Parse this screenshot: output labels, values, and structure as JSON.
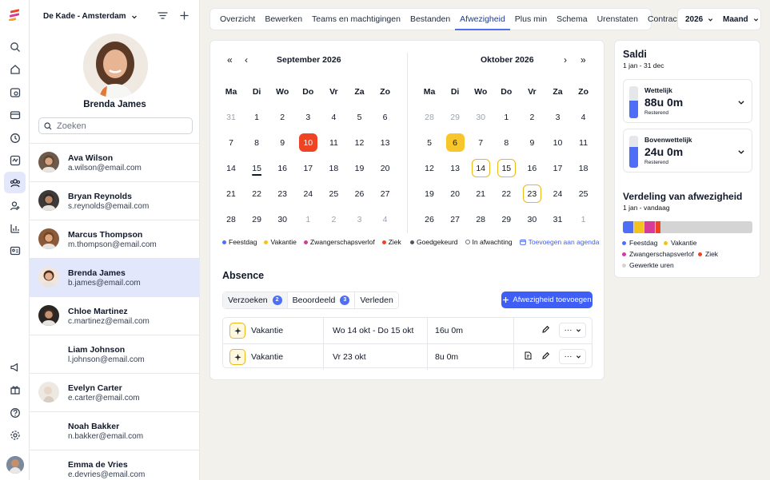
{
  "sidebar": {
    "location": "De Kade - Amsterdam",
    "profile_name": "Brenda James",
    "search_placeholder": "Zoeken",
    "people": [
      {
        "name": "Ava Wilson",
        "email": "a.wilson@email.com",
        "avatar": "photo"
      },
      {
        "name": "Bryan Reynolds",
        "email": "s.reynolds@email.com",
        "avatar": "photo"
      },
      {
        "name": "Marcus Thompson",
        "email": "m.thompson@email.com",
        "avatar": "photo"
      },
      {
        "name": "Brenda James",
        "email": "b.james@email.com",
        "avatar": "photo",
        "selected": true
      },
      {
        "name": "Chloe Martinez",
        "email": "c.martinez@email.com",
        "avatar": "photo"
      },
      {
        "name": "Liam Johnson",
        "email": "l.johnson@email.com",
        "avatar": "none"
      },
      {
        "name": "Evelyn Carter",
        "email": "e.carter@email.com",
        "avatar": "placeholder"
      },
      {
        "name": "Noah Bakker",
        "email": "n.bakker@email.com",
        "avatar": "none"
      },
      {
        "name": "Emma de Vries",
        "email": "e.devries@email.com",
        "avatar": "none"
      }
    ]
  },
  "rail_icons": [
    "search-icon",
    "home-icon",
    "inbox-search-icon",
    "calendar-card-icon",
    "clock-icon",
    "activity-icon",
    "team-icon",
    "add-user-icon",
    "chart-icon",
    "id-card-icon",
    "megaphone-icon",
    "gift-icon",
    "help-icon",
    "settings-icon"
  ],
  "tabs": [
    {
      "label": "Overzicht"
    },
    {
      "label": "Bewerken"
    },
    {
      "label": "Teams en machtigingen"
    },
    {
      "label": "Bestanden"
    },
    {
      "label": "Afwezigheid",
      "active": true
    },
    {
      "label": "Plus min"
    },
    {
      "label": "Schema"
    },
    {
      "label": "Urenstaten"
    },
    {
      "label": "Contracten"
    }
  ],
  "period": {
    "year": "2026",
    "view": "Maand"
  },
  "calendar": {
    "weekdays": [
      "Ma",
      "Di",
      "Wo",
      "Do",
      "Vr",
      "Za",
      "Zo"
    ],
    "months": [
      {
        "title": "September 2026",
        "days": [
          [
            "31",
            1
          ],
          [
            "1",
            0
          ],
          [
            "2",
            0
          ],
          [
            "3",
            0
          ],
          [
            "4",
            0
          ],
          [
            "5",
            0
          ],
          [
            "6",
            0
          ],
          [
            "7",
            0
          ],
          [
            "8",
            0
          ],
          [
            "9",
            0
          ],
          [
            "10",
            2
          ],
          [
            "11",
            0
          ],
          [
            "12",
            0
          ],
          [
            "13",
            0
          ],
          [
            "14",
            0
          ],
          [
            "15",
            3
          ],
          [
            "16",
            0
          ],
          [
            "17",
            0
          ],
          [
            "18",
            0
          ],
          [
            "19",
            0
          ],
          [
            "20",
            0
          ],
          [
            "21",
            0
          ],
          [
            "22",
            0
          ],
          [
            "23",
            0
          ],
          [
            "24",
            0
          ],
          [
            "25",
            0
          ],
          [
            "26",
            0
          ],
          [
            "27",
            0
          ],
          [
            "28",
            0
          ],
          [
            "29",
            0
          ],
          [
            "30",
            0
          ],
          [
            "1",
            1
          ],
          [
            "2",
            1
          ],
          [
            "3",
            1
          ],
          [
            "4",
            1
          ]
        ]
      },
      {
        "title": "Oktober 2026",
        "days": [
          [
            "28",
            1
          ],
          [
            "29",
            1
          ],
          [
            "30",
            1
          ],
          [
            "1",
            0
          ],
          [
            "2",
            0
          ],
          [
            "3",
            0
          ],
          [
            "4",
            0
          ],
          [
            "5",
            0
          ],
          [
            "6",
            4
          ],
          [
            "7",
            0
          ],
          [
            "8",
            0
          ],
          [
            "9",
            0
          ],
          [
            "10",
            0
          ],
          [
            "11",
            0
          ],
          [
            "12",
            0
          ],
          [
            "13",
            0
          ],
          [
            "14",
            5
          ],
          [
            "15",
            5
          ],
          [
            "16",
            0
          ],
          [
            "17",
            0
          ],
          [
            "18",
            0
          ],
          [
            "19",
            0
          ],
          [
            "20",
            0
          ],
          [
            "21",
            0
          ],
          [
            "22",
            0
          ],
          [
            "23",
            5
          ],
          [
            "24",
            0
          ],
          [
            "25",
            0
          ],
          [
            "26",
            0
          ],
          [
            "27",
            0
          ],
          [
            "28",
            0
          ],
          [
            "29",
            0
          ],
          [
            "30",
            0
          ],
          [
            "31",
            0
          ],
          [
            "1",
            1
          ]
        ]
      }
    ],
    "legend_left": [
      {
        "label": "Feestdag",
        "color": "#4f6ef7"
      },
      {
        "label": "Vakantie",
        "color": "#f4c21d"
      },
      {
        "label": "Zwangerschapsverlof",
        "color": "#d63c97"
      },
      {
        "label": "Ziek",
        "color": "#ef4423"
      }
    ],
    "legend_right": {
      "approved": "Goedgekeurd",
      "pending": "In afwachting",
      "add": "Toevoegen aan agenda"
    }
  },
  "absence": {
    "title": "Absence",
    "tabs": [
      {
        "label": "Verzoeken",
        "count": "2"
      },
      {
        "label": "Beoordeeld",
        "count": "3"
      },
      {
        "label": "Verleden"
      }
    ],
    "add_label": "Afwezigheid toevoegen",
    "rows": [
      {
        "type": "Vakantie",
        "period": "Wo 14 okt - Do 15 okt",
        "duration": "16u 0m"
      },
      {
        "type": "Vakantie",
        "period": "Vr 23 okt",
        "duration": "8u 0m"
      }
    ]
  },
  "saldi": {
    "title": "Saldi",
    "range": "1 jan - 31 dec",
    "items": [
      {
        "label": "Wettelijk",
        "value": "88u 0m",
        "sub": "Resterend",
        "fill": 0.55
      },
      {
        "label": "Bovenwettelijk",
        "value": "24u 0m",
        "sub": "Resterend",
        "fill": 0.65
      }
    ]
  },
  "distribution": {
    "title": "Verdeling van afwezigheid",
    "range": "1 jan - vandaag",
    "segments": [
      {
        "label": "Feestdag",
        "color": "#4f6ef7",
        "share": 0.08
      },
      {
        "label": "Vakantie",
        "color": "#f4c21d",
        "share": 0.08
      },
      {
        "label": "Zwangerschapsverlof",
        "color": "#d63c97",
        "share": 0.08
      },
      {
        "label": "Ziek",
        "color": "#ef4423",
        "share": 0.04
      },
      {
        "label": "Gewerkte uren",
        "color": "#d4d4d4",
        "share": 0.72
      }
    ]
  }
}
